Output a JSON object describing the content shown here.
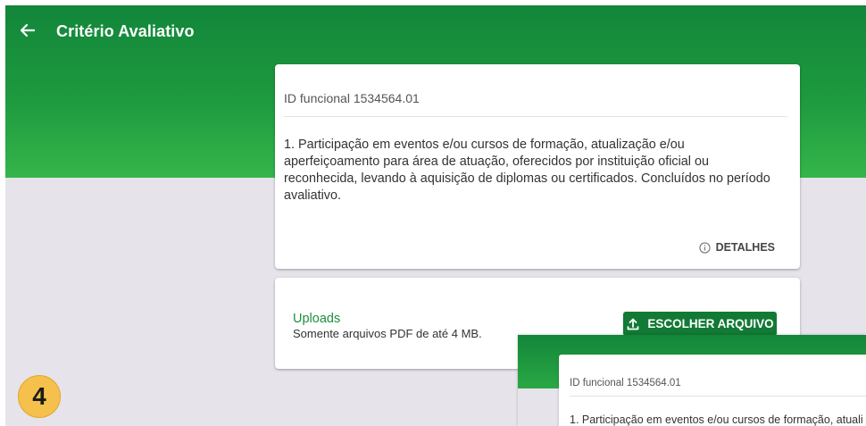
{
  "header": {
    "back_icon": "arrow-left-icon",
    "title": "Critério Avaliativo"
  },
  "criterion_card": {
    "id_line": "ID funcional 1534564.01",
    "description": "1. Participação em eventos e/ou cursos de formação, atualização e/ou aperfeiçoamento para área de atuação, oferecidos por instituição oficial ou reconhecida, levando à aquisição de diplomas ou certificados. Concluídos no período avaliativo.",
    "details_label": "DETALHES",
    "details_icon": "info-icon"
  },
  "uploads_card": {
    "title": "Uploads",
    "subtitle": "Somente arquivos PDF de até 4 MB.",
    "button_label": "ESCOLHER ARQUIVO",
    "button_icon": "upload-icon"
  },
  "step_badge": "4",
  "inset_preview": {
    "id_line": "ID funcional 1534564.01",
    "description": "1. Participação em eventos e/ou cursos de formação, atuali"
  },
  "colors": {
    "primary_green": "#1e9a3f",
    "button_green": "#127a35",
    "uploads_title_green": "#1e8e3e",
    "background": "#e6e3ea",
    "badge_yellow": "#f5c04b"
  }
}
